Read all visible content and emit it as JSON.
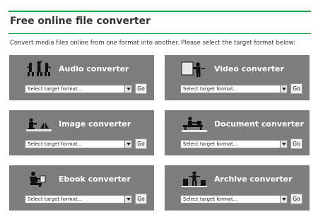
{
  "page": {
    "title": "Free online file converter",
    "intro": "Convert media files online from one format into another. Please select the target format below:"
  },
  "converters": [
    {
      "title": "Audio converter",
      "select_value": "Select target format...",
      "go_label": "Go",
      "icon": "audio-people-icon"
    },
    {
      "title": "Video converter",
      "select_value": "Select target format...",
      "go_label": "Go",
      "icon": "video-camera-icon"
    },
    {
      "title": "Image converter",
      "select_value": "Select target format...",
      "go_label": "Go",
      "icon": "image-camera-icon"
    },
    {
      "title": "Document converter",
      "select_value": "Select target format...",
      "go_label": "Go",
      "icon": "document-desk-icon"
    },
    {
      "title": "Ebook converter",
      "select_value": "Select target format...",
      "go_label": "Go",
      "icon": "ebook-reader-icon"
    },
    {
      "title": "Archive converter",
      "select_value": "Select target format...",
      "go_label": "Go",
      "icon": "archive-worker-icon"
    }
  ],
  "colors": {
    "accent": "#1fa347",
    "card_bg": "#7d7d7d",
    "card_text": "#ffffff"
  }
}
